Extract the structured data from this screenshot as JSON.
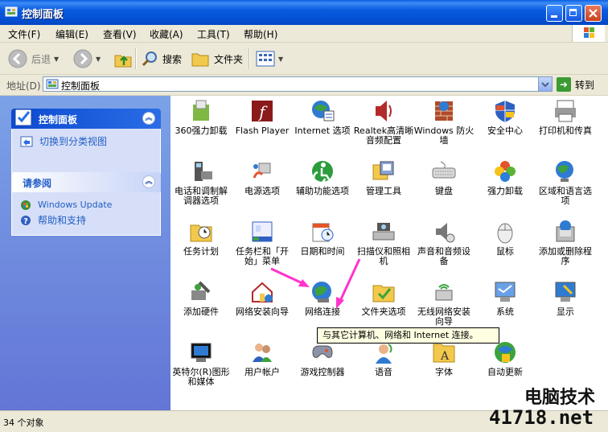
{
  "window": {
    "title": "控制面板"
  },
  "menu": [
    "文件(F)",
    "编辑(E)",
    "查看(V)",
    "收藏(A)",
    "工具(T)",
    "帮助(H)"
  ],
  "toolbar": {
    "back": "后退",
    "search": "搜索",
    "folders": "文件夹"
  },
  "address": {
    "label": "地址(D)",
    "value": "控制面板",
    "go": "转到"
  },
  "sidebar": {
    "panel1": {
      "title": "控制面板",
      "link": "切换到分类视图"
    },
    "panel2": {
      "title": "请参阅",
      "links": [
        "Windows Update",
        "帮助和支持"
      ]
    }
  },
  "items": [
    "360强力卸载",
    "Flash Player",
    "Internet 选项",
    "Realtek高清晰音频配置",
    "Windows 防火墙",
    "安全中心",
    "打印机和传真",
    "电话和调制解调器选项",
    "电源选项",
    "辅助功能选项",
    "管理工具",
    "键盘",
    "强力卸载",
    "区域和语言选项",
    "任务计划",
    "任务栏和「开始」菜单",
    "日期和时间",
    "扫描仪和照相机",
    "声音和音频设备",
    "鼠标",
    "添加或删除程序",
    "添加硬件",
    "网络安装向导",
    "网络连接",
    "文件夹选项",
    "无线网络安装向导",
    "系统",
    "显示",
    "英特尔(R)图形和媒体",
    "用户帐户",
    "游戏控制器",
    "语音",
    "字体",
    "自动更新"
  ],
  "tooltip": "与其它计算机、网络和 Internet 连接。",
  "status": "34 个对象",
  "watermark": {
    "line1": "电脑技术",
    "line2": "41718.net"
  },
  "colors": {
    "titlebar": "#0553d6",
    "sidebar": "#6f8fdf",
    "link": "#215dc6",
    "arrow": "#ff33cc"
  }
}
